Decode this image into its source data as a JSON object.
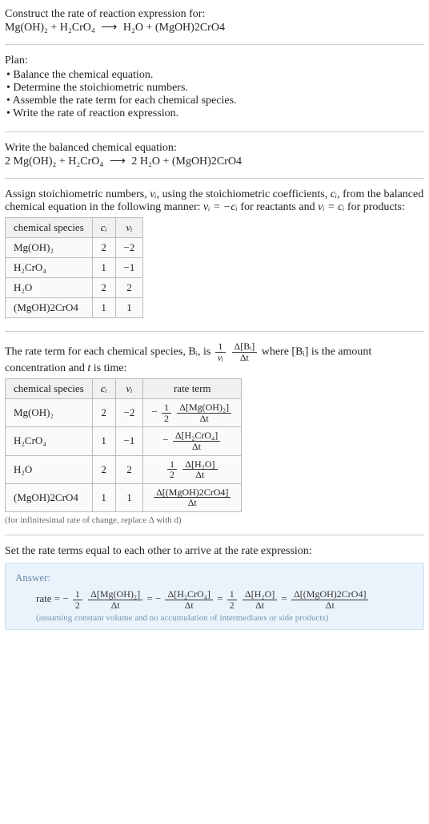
{
  "intro": {
    "line1": "Construct the rate of reaction expression for:",
    "equation_left": "Mg(OH)₂ + H₂CrO₄",
    "arrow": "⟶",
    "equation_right": "H₂O + (MgOH)2CrO4"
  },
  "plan": {
    "title": "Plan:",
    "items": [
      "Balance the chemical equation.",
      "Determine the stoichiometric numbers.",
      "Assemble the rate term for each chemical species.",
      "Write the rate of reaction expression."
    ]
  },
  "balanced": {
    "intro": "Write the balanced chemical equation:",
    "left": "2 Mg(OH)₂ + H₂CrO₄",
    "arrow": "⟶",
    "right": "2 H₂O + (MgOH)2CrO4"
  },
  "stoich_text": {
    "part1": "Assign stoichiometric numbers, ",
    "nu_i": "νᵢ",
    "part2": ", using the stoichiometric coefficients, ",
    "c_i": "cᵢ",
    "part3": ", from the balanced chemical equation in the following manner: ",
    "rel_reactants": "νᵢ = −cᵢ",
    "part4": " for reactants and ",
    "rel_products": "νᵢ = cᵢ",
    "part5": " for products:"
  },
  "table1": {
    "headers": [
      "chemical species",
      "cᵢ",
      "νᵢ"
    ],
    "rows": [
      {
        "species": "Mg(OH)₂",
        "c": "2",
        "nu": "−2"
      },
      {
        "species": "H₂CrO₄",
        "c": "1",
        "nu": "−1"
      },
      {
        "species": "H₂O",
        "c": "2",
        "nu": "2"
      },
      {
        "species": "(MgOH)2CrO4",
        "c": "1",
        "nu": "1"
      }
    ]
  },
  "rate_term_text": {
    "part1": "The rate term for each chemical species, Bᵢ, is ",
    "frac1_num": "1",
    "frac1_den": "νᵢ",
    "frac2_num": "Δ[Bᵢ]",
    "frac2_den": "Δt",
    "part2": " where [Bᵢ] is the amount concentration and ",
    "t": "t",
    "part3": " is time:"
  },
  "table2": {
    "headers": [
      "chemical species",
      "cᵢ",
      "νᵢ",
      "rate term"
    ],
    "rows": [
      {
        "species": "Mg(OH)₂",
        "c": "2",
        "nu": "−2",
        "prefix": "−",
        "coef_num": "1",
        "coef_den": "2",
        "conc_num": "Δ[Mg(OH)₂]",
        "conc_den": "Δt"
      },
      {
        "species": "H₂CrO₄",
        "c": "1",
        "nu": "−1",
        "prefix": "−",
        "coef_num": "",
        "coef_den": "",
        "conc_num": "Δ[H₂CrO₄]",
        "conc_den": "Δt"
      },
      {
        "species": "H₂O",
        "c": "2",
        "nu": "2",
        "prefix": "",
        "coef_num": "1",
        "coef_den": "2",
        "conc_num": "Δ[H₂O]",
        "conc_den": "Δt"
      },
      {
        "species": "(MgOH)2CrO4",
        "c": "1",
        "nu": "1",
        "prefix": "",
        "coef_num": "",
        "coef_den": "",
        "conc_num": "Δ[(MgOH)2CrO4]",
        "conc_den": "Δt"
      }
    ],
    "note": "(for infinitesimal rate of change, replace Δ with d)"
  },
  "final_text": "Set the rate terms equal to each other to arrive at the rate expression:",
  "answer": {
    "label": "Answer:",
    "rate_label": "rate",
    "eq": "=",
    "terms": [
      {
        "prefix": "−",
        "coef_num": "1",
        "coef_den": "2",
        "conc_num": "Δ[Mg(OH)₂]",
        "conc_den": "Δt"
      },
      {
        "prefix": "= −",
        "coef_num": "",
        "coef_den": "",
        "conc_num": "Δ[H₂CrO₄]",
        "conc_den": "Δt"
      },
      {
        "prefix": "=",
        "coef_num": "1",
        "coef_den": "2",
        "conc_num": "Δ[H₂O]",
        "conc_den": "Δt"
      },
      {
        "prefix": "=",
        "coef_num": "",
        "coef_den": "",
        "conc_num": "Δ[(MgOH)2CrO4]",
        "conc_den": "Δt"
      }
    ],
    "assume": "(assuming constant volume and no accumulation of intermediates or side products)"
  }
}
